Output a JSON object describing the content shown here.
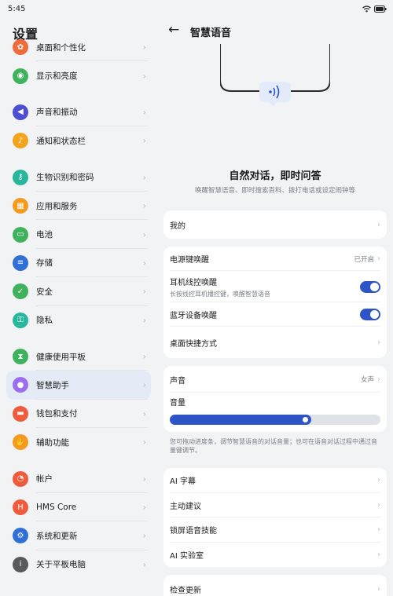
{
  "status": {
    "time": "5:45"
  },
  "left": {
    "title": "设置",
    "groups": [
      {
        "items": [
          {
            "label": "桌面和个性化",
            "icon": "palette-icon",
            "color": "#ef6b3c"
          },
          {
            "label": "显示和亮度",
            "icon": "eye-icon",
            "color": "#3fb25e"
          }
        ]
      },
      {
        "items": [
          {
            "label": "声音和振动",
            "icon": "speaker-icon",
            "color": "#4b4fd6"
          },
          {
            "label": "通知和状态栏",
            "icon": "bell-icon",
            "color": "#f4a31c"
          }
        ]
      },
      {
        "items": [
          {
            "label": "生物识别和密码",
            "icon": "key-icon",
            "color": "#28b69c"
          },
          {
            "label": "应用和服务",
            "icon": "grid-icon",
            "color": "#f39a1f"
          },
          {
            "label": "电池",
            "icon": "battery-icon",
            "color": "#3fb25e"
          },
          {
            "label": "存储",
            "icon": "storage-icon",
            "color": "#2f6fd6"
          },
          {
            "label": "安全",
            "icon": "shield-icon",
            "color": "#3fb25e"
          },
          {
            "label": "隐私",
            "icon": "lock-shield-icon",
            "color": "#28b69c"
          }
        ]
      },
      {
        "items": [
          {
            "label": "健康使用平板",
            "icon": "hourglass-icon",
            "color": "#3fb25e"
          },
          {
            "label": "智慧助手",
            "icon": "assistant-icon",
            "color": "#9b6ef0"
          },
          {
            "label": "钱包和支付",
            "icon": "wallet-icon",
            "color": "#ef5b3c"
          },
          {
            "label": "辅助功能",
            "icon": "hand-icon",
            "color": "#f39a1f"
          }
        ]
      },
      {
        "items": [
          {
            "label": "帐户",
            "icon": "user-icon",
            "color": "#ef5b3c"
          },
          {
            "label": "HMS Core",
            "icon": "hms-icon",
            "color": "#ef5b3c"
          },
          {
            "label": "系统和更新",
            "icon": "gear-icon",
            "color": "#2f6fd6"
          },
          {
            "label": "关于平板电脑",
            "icon": "info-icon",
            "color": "#5a5a5a"
          }
        ]
      }
    ]
  },
  "right": {
    "title": "智慧语音",
    "hero_title": "自然对话，即时问答",
    "hero_sub": "唤醒智慧语音、即时搜索百科、拨打电话或设定闹钟等",
    "mine": "我的",
    "power_key": {
      "label": "电源键唤醒",
      "value": "已开启"
    },
    "earphone": {
      "label": "耳机线控唤醒",
      "sub": "长按线控耳机播控键，唤醒智慧语音"
    },
    "bluetooth": {
      "label": "蓝牙设备唤醒"
    },
    "desktop": {
      "label": "桌面快捷方式"
    },
    "sound": {
      "label": "声音",
      "value": "女声"
    },
    "volume": {
      "label": "音量",
      "level_percent": 67
    },
    "note": "您可拖动进度条，调节智慧语音的对话音量；也可在语音对话过程中通过音量键调节。",
    "more": [
      "AI 字幕",
      "主动建议",
      "锁屏语音技能",
      "AI 实验室"
    ],
    "check_update": "检查更新"
  }
}
